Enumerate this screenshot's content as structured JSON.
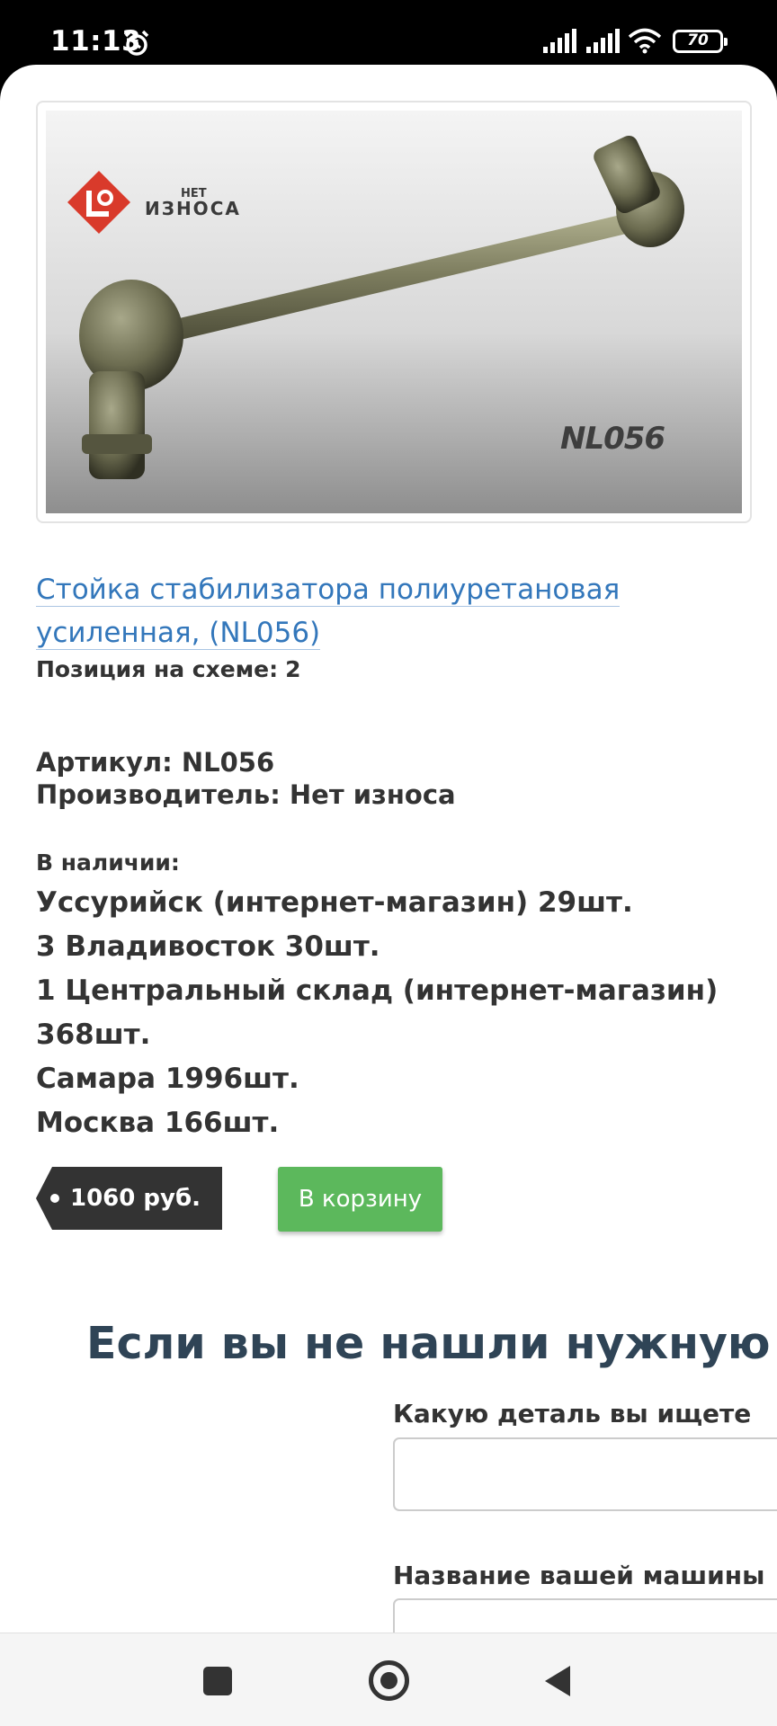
{
  "status_bar": {
    "time": "11:13",
    "battery": "70",
    "icons": [
      "alarm-icon",
      "signal-icon",
      "signal-icon",
      "wifi-icon",
      "battery-icon"
    ]
  },
  "product": {
    "image": {
      "brand_logo": "НЕТ ИЗНОСА",
      "part_label": "NL056",
      "colors": {
        "rod": "#8a8a6a",
        "logo_red": "#d93a2b"
      }
    },
    "title": "Стойка стабилизатора полиуретановая усиленная, (NL056)",
    "position_label": "Позиция на схеме:",
    "position_value": "2",
    "article": "Артикул: NL056",
    "vendor": "Производитель: Нет износа",
    "stock_label": "В наличии:",
    "stock": [
      "Уссурийск (интернет-магазин) 29шт.",
      "3 Владивосток 30шт.",
      "1 Центральный склад (интернет-магазин) 368шт.",
      "Самара 1996шт.",
      "Москва 166шт."
    ],
    "price": "1060 руб.",
    "cart_button": "В корзину"
  },
  "request_form": {
    "heading": "Если вы не нашли нужную запча",
    "part_label": "Какую деталь вы ищете",
    "part_value": "",
    "car_label": "Название вашей машины",
    "car_value": ""
  },
  "colors": {
    "link": "#3377bb",
    "button_green": "#5cb85c",
    "price_tag": "#333333",
    "heading": "#2f4456"
  },
  "nav_bar": {
    "icons": [
      "recents-square-icon",
      "home-circle-icon",
      "back-triangle-icon"
    ]
  }
}
